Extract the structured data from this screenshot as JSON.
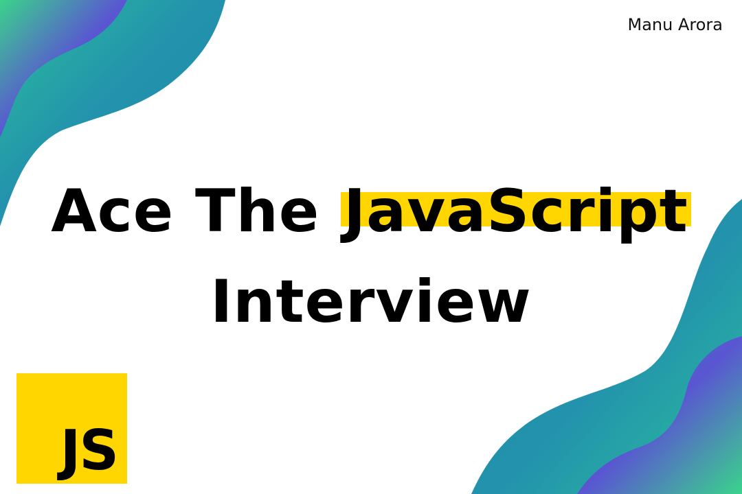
{
  "author": "Manu Arora",
  "title": {
    "prefix": "Ace The ",
    "highlight": "JavaScript",
    "line2": "Interview"
  },
  "badge": {
    "label": "JS"
  },
  "colors": {
    "highlight": "#ffd600",
    "wave_green": "#38d39f",
    "wave_teal": "#2196a8",
    "wave_purple": "#5a55d2",
    "badge_bg": "#ffd600"
  }
}
